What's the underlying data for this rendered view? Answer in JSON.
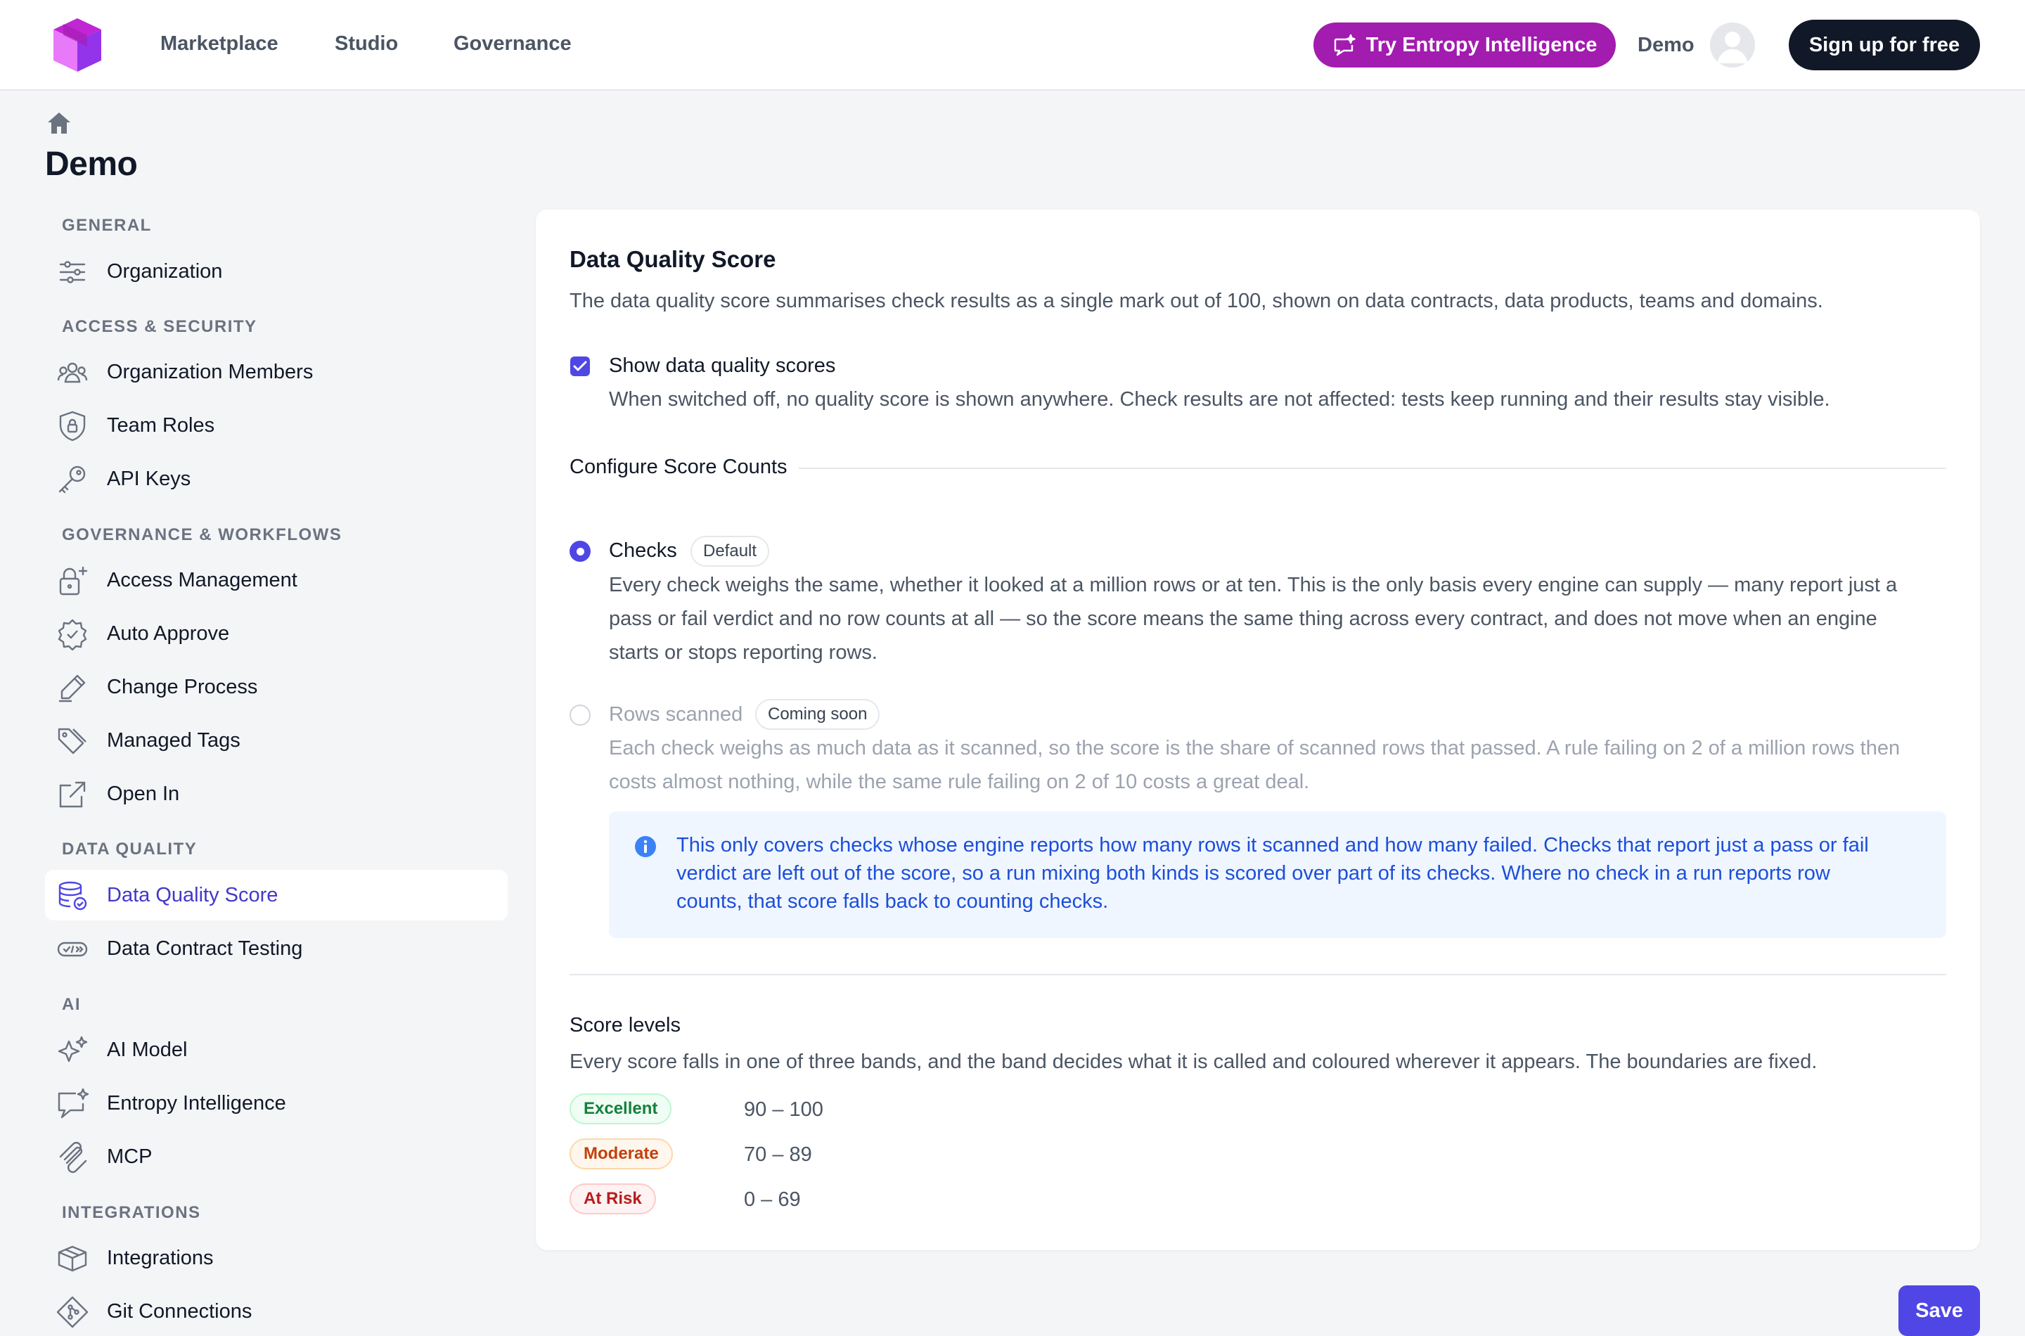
{
  "nav": {
    "links": [
      "Marketplace",
      "Studio",
      "Governance"
    ],
    "ai_button": "Try Entropy Intelligence",
    "user_name": "Demo",
    "signup": "Sign up for free"
  },
  "sidebar": {
    "title": "Demo",
    "sections": {
      "general": "GENERAL",
      "access": "ACCESS & SECURITY",
      "governance": "GOVERNANCE & WORKFLOWS",
      "quality": "DATA QUALITY",
      "ai": "AI",
      "integrations": "INTEGRATIONS"
    },
    "items": {
      "organization": "Organization",
      "members": "Organization Members",
      "team_roles": "Team Roles",
      "api_keys": "API Keys",
      "access_mgmt": "Access Management",
      "auto_approve": "Auto Approve",
      "change_process": "Change Process",
      "managed_tags": "Managed Tags",
      "open_in": "Open In",
      "dq_score": "Data Quality Score",
      "dc_testing": "Data Contract Testing",
      "ai_model": "AI Model",
      "entropy": "Entropy Intelligence",
      "mcp": "MCP",
      "integrations": "Integrations",
      "git": "Git Connections"
    }
  },
  "main": {
    "title": "Data Quality Score",
    "subtitle": "The data quality score summarises check results as a single mark out of 100, shown on data contracts, data products, teams and domains.",
    "show_scores": {
      "label": "Show data quality scores",
      "checked": true,
      "help": "When switched off, no quality score is shown anywhere. Check results are not affected: tests keep running and their results stay visible."
    },
    "score_counts": {
      "heading": "Configure Score Counts",
      "checks": {
        "label": "Checks",
        "badge": "Default",
        "selected": true,
        "line1": "Every check weighs the same, whether it looked at a million rows or at ten. This is the only basis every engine can supply — many report just a",
        "line2": "pass or fail verdict and no row counts at all — so the score means the same thing across every contract, and does not move when an engine",
        "line3": "starts or stops reporting rows."
      },
      "rows": {
        "label": "Rows scanned",
        "badge": "Coming soon",
        "selected": false,
        "line1": "Each check weighs as much data as it scanned, so the score is the share of scanned rows that passed. A rule failing on 2 of a million rows then",
        "line2": "costs almost nothing, while the same rule failing on 2 of 10 costs a great deal."
      },
      "info": {
        "line1": "This only covers checks whose engine reports how many rows it scanned and how many failed. Checks that report just a pass or fail",
        "line2": "verdict are left out of the score, so a run mixing both kinds is scored over part of its checks. Where no check in a run reports row",
        "line3": "counts, that score falls back to counting checks."
      }
    },
    "levels": {
      "heading": "Score levels",
      "desc": "Every score falls in one of three bands, and the band decides what it is called and coloured wherever it appears. The boundaries are fixed.",
      "bands": [
        {
          "label": "Excellent",
          "range": "90 – 100",
          "color": "#15803d"
        },
        {
          "label": "Moderate",
          "range": "70 – 89",
          "color": "#c2410c"
        },
        {
          "label": "At Risk",
          "range": "0 – 69",
          "color": "#b91c1c"
        }
      ]
    },
    "save": "Save"
  }
}
